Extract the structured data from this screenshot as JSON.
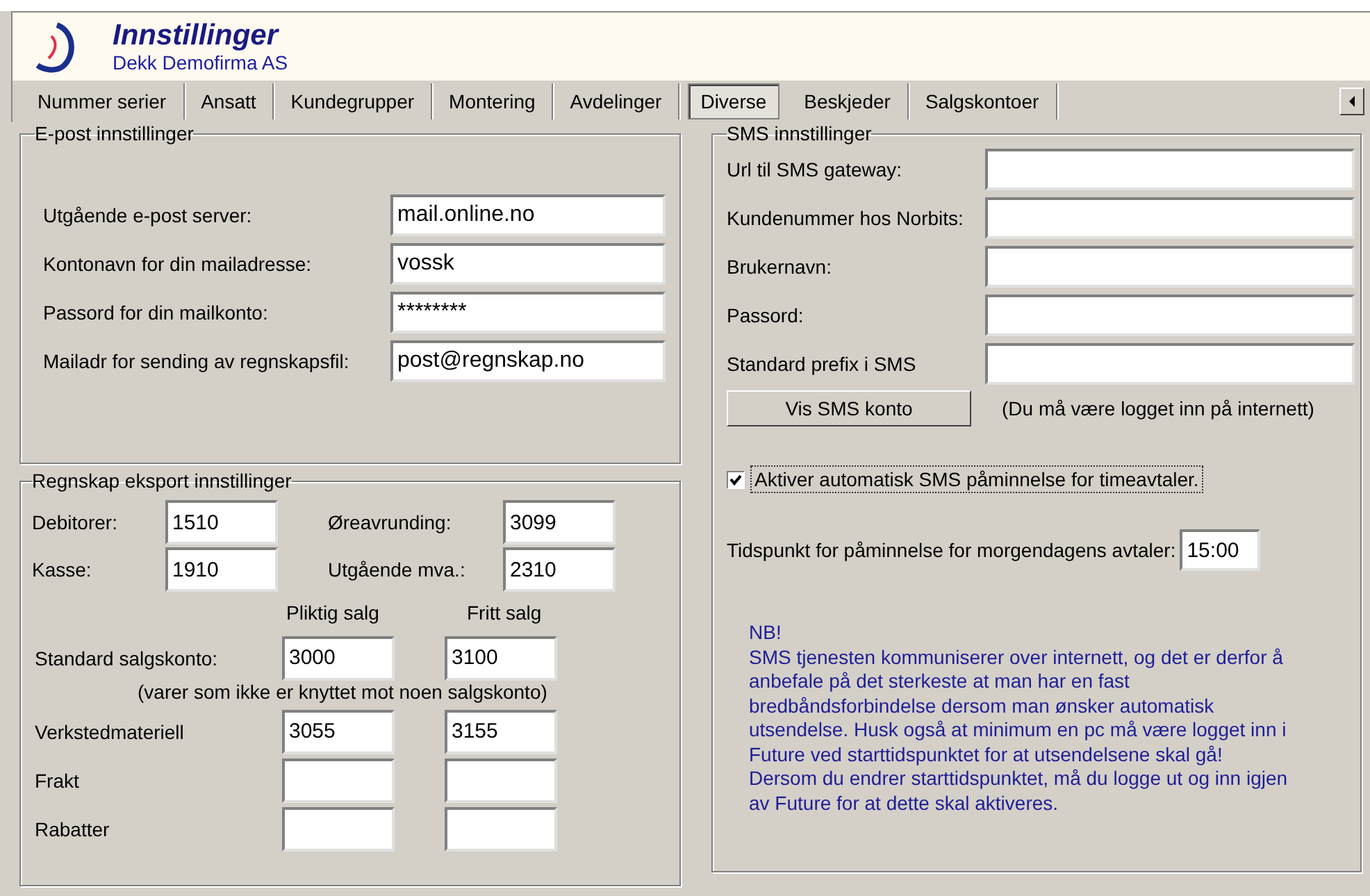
{
  "header": {
    "title": "Innstillinger",
    "company": "Dekk Demofirma AS"
  },
  "tabs": [
    {
      "label": "Nummer serier",
      "selected": false
    },
    {
      "label": "Ansatt",
      "selected": false
    },
    {
      "label": "Kundegrupper",
      "selected": false
    },
    {
      "label": "Montering",
      "selected": false
    },
    {
      "label": "Avdelinger",
      "selected": false
    },
    {
      "label": "Diverse",
      "selected": true
    },
    {
      "label": "Beskjeder",
      "selected": false
    },
    {
      "label": "Salgskontoer",
      "selected": false
    }
  ],
  "email": {
    "title": "E-post innstillinger",
    "fields": [
      {
        "label": "Utgående e-post server:",
        "value": "mail.online.no"
      },
      {
        "label": "Kontonavn for din mailadresse:",
        "value": "vossk"
      },
      {
        "label": "Passord for din mailkonto:",
        "value": "********"
      },
      {
        "label": "Mailadr for sending av regnskapsfil:",
        "value": "post@regnskap.no"
      }
    ]
  },
  "accounting": {
    "title": "Regnskap eksport innstillinger",
    "left_fields": [
      {
        "label": "Debitorer:",
        "value": "1510"
      },
      {
        "label": "Kasse:",
        "value": "1910"
      }
    ],
    "right_fields": [
      {
        "label": "Øreavrunding:",
        "value": "3099"
      },
      {
        "label": "Utgående mva.:",
        "value": "2310"
      }
    ],
    "columns": [
      "Pliktig salg",
      "Fritt salg"
    ],
    "rows": [
      {
        "label": "Standard salgskonto:",
        "values": [
          "3000",
          "3100"
        ]
      },
      {
        "label": "Verkstedmateriell",
        "values": [
          "3055",
          "3155"
        ]
      },
      {
        "label": "Frakt"
      },
      {
        "label": "Rabatter"
      }
    ],
    "note": "(varer som ikke er knyttet mot noen salgskonto)"
  },
  "sms": {
    "title": "SMS innstillinger",
    "fields": [
      {
        "label": "Url til SMS gateway:"
      },
      {
        "label": "Kundenummer hos Norbits:"
      },
      {
        "label": "Brukernavn:"
      },
      {
        "label": "Passord:"
      },
      {
        "label": "Standard prefix i SMS"
      }
    ],
    "button": "Vis SMS konto",
    "button_note": "(Du må være logget inn på internett)",
    "checkbox": {
      "label": "Aktiver automatisk SMS påminnelse for timeavtaler.",
      "checked": true
    },
    "time": {
      "label": "Tidspunkt for påminnelse for morgendagens avtaler:",
      "value": "15:00"
    },
    "notice": [
      "NB!",
      "SMS tjenesten kommuniserer over internett, og det er derfor å",
      "anbefale på det sterkeste at man har en fast",
      "bredbåndsforbindelse dersom man ønsker automatisk",
      "utsendelse. Husk også at minimum en pc må være logget inn i",
      "Future ved starttidspunktet for at utsendelsene skal gå!",
      "Dersom du endrer starttidspunktet, må du logge ut og inn igjen",
      "av Future for at dette skal aktiveres."
    ]
  }
}
